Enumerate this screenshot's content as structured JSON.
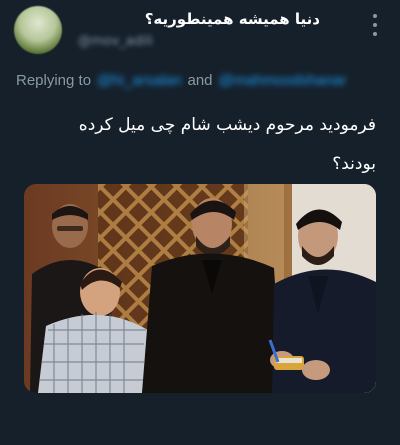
{
  "tweet": {
    "display_name": "دنیا همیشه همینطوریه؟",
    "handle": "@mov_adili",
    "reply_prefix": "Replying to",
    "reply_mentions": [
      "@hi_arsalan",
      "@mahmoodshanar"
    ],
    "reply_joiner": "and",
    "text": "فرمودید مرحوم دیشب شام چی میل کرده\nبودند؟",
    "more_icon": "more-horizontal-dots-icon",
    "media": {
      "kind": "photo"
    }
  },
  "colors": {
    "background": "#15202b",
    "text_primary": "#ffffff",
    "text_secondary": "#8899a6",
    "accent": "#1d9bf0"
  }
}
